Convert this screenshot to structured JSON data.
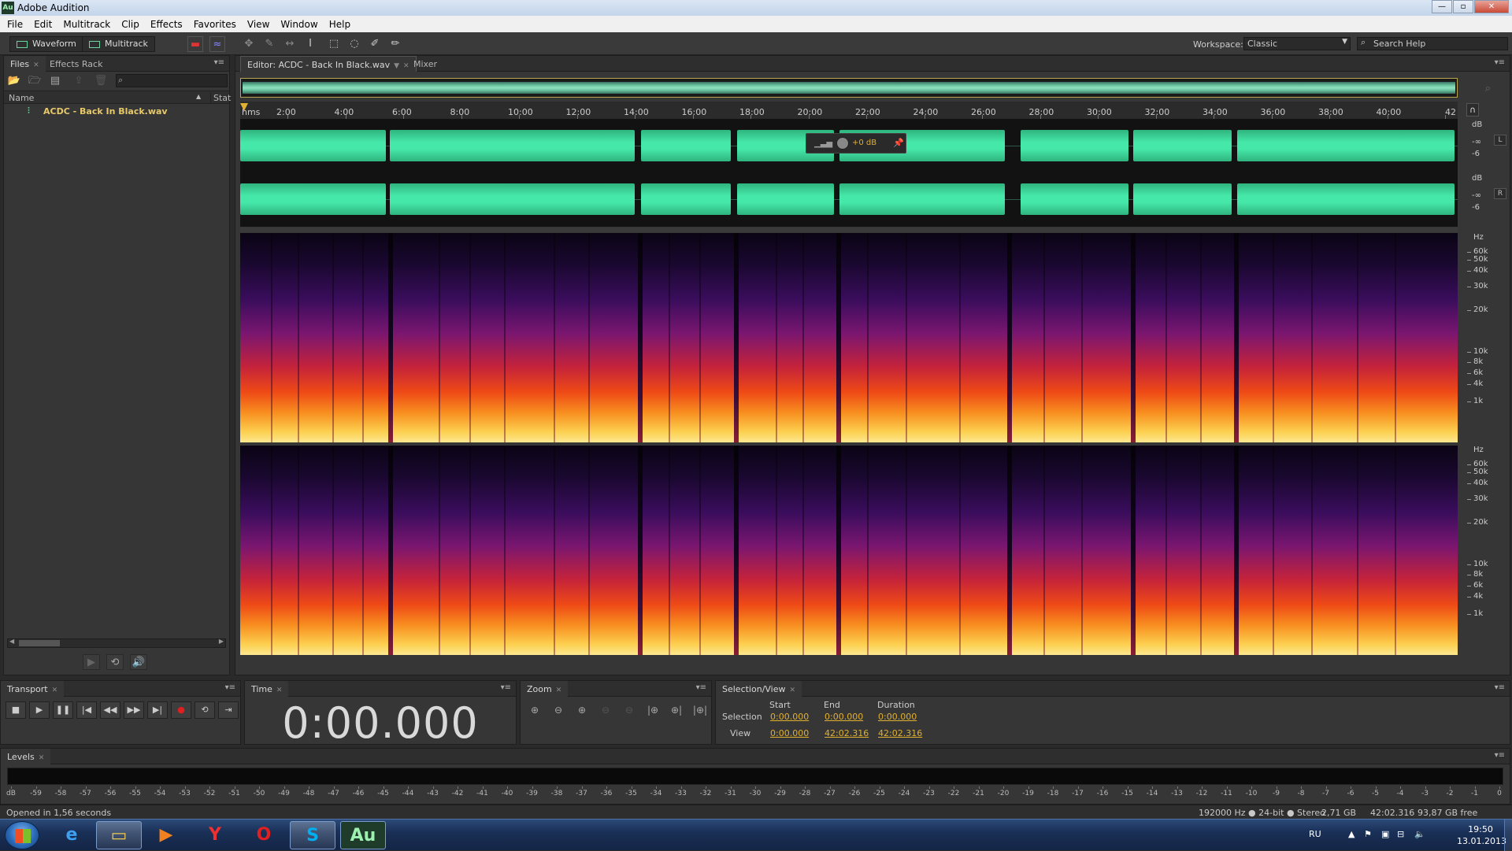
{
  "window": {
    "title": "Adobe Audition",
    "app_icon": "Au"
  },
  "menu": [
    "File",
    "Edit",
    "Multitrack",
    "Clip",
    "Effects",
    "Favorites",
    "View",
    "Window",
    "Help"
  ],
  "toolbar": {
    "waveform_label": "Waveform",
    "multitrack_label": "Multitrack",
    "workspace_label": "Workspace:",
    "workspace_value": "Classic",
    "search_placeholder": "Search Help"
  },
  "files_panel": {
    "tabs": [
      "Files",
      "Effects Rack"
    ],
    "columns": [
      "Name",
      "Stat"
    ],
    "file_name": "ACDC - Back In Black.wav"
  },
  "editor": {
    "tabs": [
      "Editor: ACDC - Back In Black.wav",
      "Mixer"
    ],
    "ruler_unit": "hms",
    "ruler_ticks": [
      "2:00",
      "4:00",
      "6:00",
      "8:00",
      "10:00",
      "12:00",
      "14:00",
      "16:00",
      "18:00",
      "20:00",
      "22:00",
      "24:00",
      "26:00",
      "28:00",
      "30:00",
      "32:00",
      "34:00",
      "36:00",
      "38:00",
      "40:00",
      "42"
    ],
    "hud_gain": "+0 dB",
    "db_unit": "dB",
    "db_inf": "-∞",
    "db_minus6": "-6",
    "channel_left": "L",
    "channel_right": "R",
    "hz_unit": "Hz",
    "hz_ticks": [
      "60k",
      "50k",
      "40k",
      "30k",
      "20k",
      "10k",
      "8k",
      "6k",
      "4k",
      "1k"
    ]
  },
  "transport": {
    "title": "Transport"
  },
  "time_panel": {
    "title": "Time",
    "time": "0:00.000"
  },
  "zoom_panel": {
    "title": "Zoom"
  },
  "selection_view": {
    "title": "Selection/View",
    "headers": [
      "Start",
      "End",
      "Duration"
    ],
    "selection_label": "Selection",
    "view_label": "View",
    "selection_start": "0:00.000",
    "selection_end": "0:00.000",
    "selection_duration": "0:00.000",
    "view_start": "0:00.000",
    "view_end": "42:02.316",
    "view_duration": "42:02.316"
  },
  "levels": {
    "title": "Levels",
    "scale": [
      "dB",
      "-59",
      "-58",
      "-57",
      "-56",
      "-55",
      "-54",
      "-53",
      "-52",
      "-51",
      "-50",
      "-49",
      "-48",
      "-47",
      "-46",
      "-45",
      "-44",
      "-43",
      "-42",
      "-41",
      "-40",
      "-39",
      "-38",
      "-37",
      "-36",
      "-35",
      "-34",
      "-33",
      "-32",
      "-31",
      "-30",
      "-29",
      "-28",
      "-27",
      "-26",
      "-25",
      "-24",
      "-23",
      "-22",
      "-21",
      "-20",
      "-19",
      "-18",
      "-17",
      "-16",
      "-15",
      "-14",
      "-13",
      "-12",
      "-11",
      "-10",
      "-9",
      "-8",
      "-7",
      "-6",
      "-5",
      "-4",
      "-3",
      "-2",
      "-1",
      "0"
    ]
  },
  "status": {
    "left": "Opened in 1,56 seconds",
    "format": "192000 Hz ● 24-bit ● Stereo",
    "size": "2,71 GB",
    "duration": "42:02.316",
    "free": "93,87 GB free"
  },
  "taskbar": {
    "apps": [
      "windows-start",
      "internet-explorer",
      "file-explorer",
      "media-player",
      "yandex-browser",
      "opera",
      "skype",
      "adobe-audition"
    ],
    "lang": "RU",
    "time": "19:50",
    "date": "13.01.2013"
  },
  "colors": {
    "waveform": "#46e8aa",
    "accent": "#e0b030",
    "background": "#363636"
  }
}
